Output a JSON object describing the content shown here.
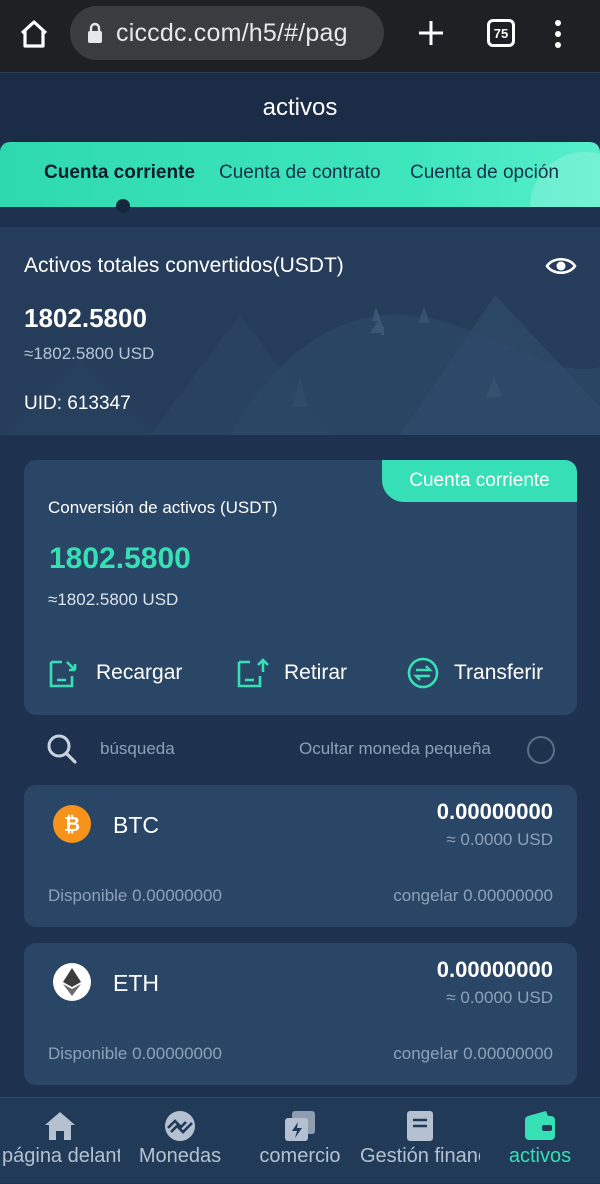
{
  "browser": {
    "url": "ciccdc.com/h5/#/pag",
    "tab_count": "75"
  },
  "header": {
    "title": "activos"
  },
  "tabs": [
    {
      "label": "Cuenta corriente",
      "active": true
    },
    {
      "label": "Cuenta de contrato",
      "active": false
    },
    {
      "label": "Cuenta de opción",
      "active": false
    }
  ],
  "summary": {
    "label": "Activos totales convertidos(USDT)",
    "value": "1802.5800",
    "usd": "≈1802.5800 USD",
    "uid": "UID: 613347"
  },
  "account_card": {
    "badge": "Cuenta corriente",
    "label": "Conversión de activos (USDT)",
    "value": "1802.5800",
    "usd": "≈1802.5800 USD",
    "actions": [
      {
        "label": "Recargar",
        "icon": "deposit-icon"
      },
      {
        "label": "Retirar",
        "icon": "withdraw-icon"
      },
      {
        "label": "Transferir",
        "icon": "transfer-icon"
      }
    ]
  },
  "search": {
    "placeholder": "búsqueda",
    "hide_small_label": "Ocultar moneda pequeña"
  },
  "coins": [
    {
      "symbol": "BTC",
      "icon": "bitcoin-icon",
      "amount": "0.00000000",
      "usd": "≈ 0.0000 USD",
      "available": "Disponible  0.00000000",
      "frozen": "congelar  0.00000000"
    },
    {
      "symbol": "ETH",
      "icon": "ethereum-icon",
      "amount": "0.00000000",
      "usd": "≈ 0.0000 USD",
      "available": "Disponible  0.00000000",
      "frozen": "congelar  0.00000000"
    }
  ],
  "bottom_nav": [
    {
      "label": "página delantera",
      "icon": "home-icon",
      "active": false
    },
    {
      "label": "Monedas",
      "icon": "coins-icon",
      "active": false
    },
    {
      "label": "comercio",
      "icon": "trade-icon",
      "active": false
    },
    {
      "label": "Gestión financiera",
      "icon": "finance-icon",
      "active": false
    },
    {
      "label": "activos",
      "icon": "wallet-icon",
      "active": true
    }
  ],
  "colors": {
    "accent": "#37dfb4",
    "background": "#1e3250",
    "card": "#2a4666",
    "bitcoin": "#f7931a"
  }
}
